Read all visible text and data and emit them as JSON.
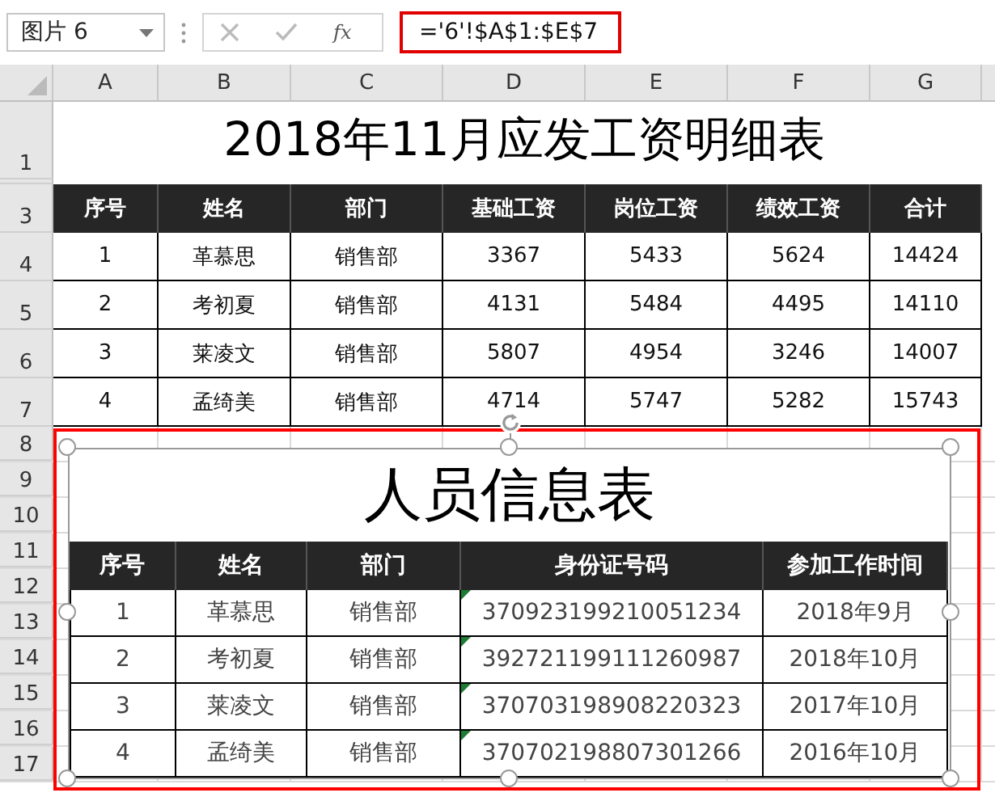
{
  "name_box": {
    "value": "图片 6"
  },
  "formula_bar": {
    "fx_label": "fx",
    "formula": "='6'!$A$1:$E$7",
    "highlighted": true
  },
  "columns": [
    "A",
    "B",
    "C",
    "D",
    "E",
    "F",
    "G"
  ],
  "row_numbers": [
    "1",
    "3",
    "4",
    "5",
    "6",
    "7",
    "8",
    "9",
    "10",
    "11",
    "12",
    "13",
    "14",
    "15",
    "16",
    "17"
  ],
  "sheet_table": {
    "title": "2018年11月应发工资明细表",
    "headers": [
      "序号",
      "姓名",
      "部门",
      "基础工资",
      "岗位工资",
      "绩效工资",
      "合计"
    ],
    "rows": [
      [
        "1",
        "革慕思",
        "销售部",
        "3367",
        "5433",
        "5624",
        "14424"
      ],
      [
        "2",
        "考初夏",
        "销售部",
        "4131",
        "5484",
        "4495",
        "14110"
      ],
      [
        "3",
        "莱凌文",
        "销售部",
        "5807",
        "4954",
        "3246",
        "14007"
      ],
      [
        "4",
        "孟绮美",
        "销售部",
        "4714",
        "5747",
        "5282",
        "15743"
      ]
    ]
  },
  "picture": {
    "selected": true,
    "title": "人员信息表",
    "headers": [
      "序号",
      "姓名",
      "部门",
      "身份证号码",
      "参加工作时间"
    ],
    "rows": [
      {
        "cells": [
          "1",
          "革慕思",
          "销售部",
          "370923199210051234",
          "2018年9月"
        ],
        "text_number_flag": true
      },
      {
        "cells": [
          "2",
          "考初夏",
          "销售部",
          "392721199111260987",
          "2018年10月"
        ],
        "text_number_flag": true
      },
      {
        "cells": [
          "3",
          "莱凌文",
          "销售部",
          "370703198908220323",
          "2017年10月"
        ],
        "text_number_flag": true
      },
      {
        "cells": [
          "4",
          "孟绮美",
          "销售部",
          "370702198807301266",
          "2016年10月"
        ],
        "text_number_flag": true
      }
    ]
  }
}
